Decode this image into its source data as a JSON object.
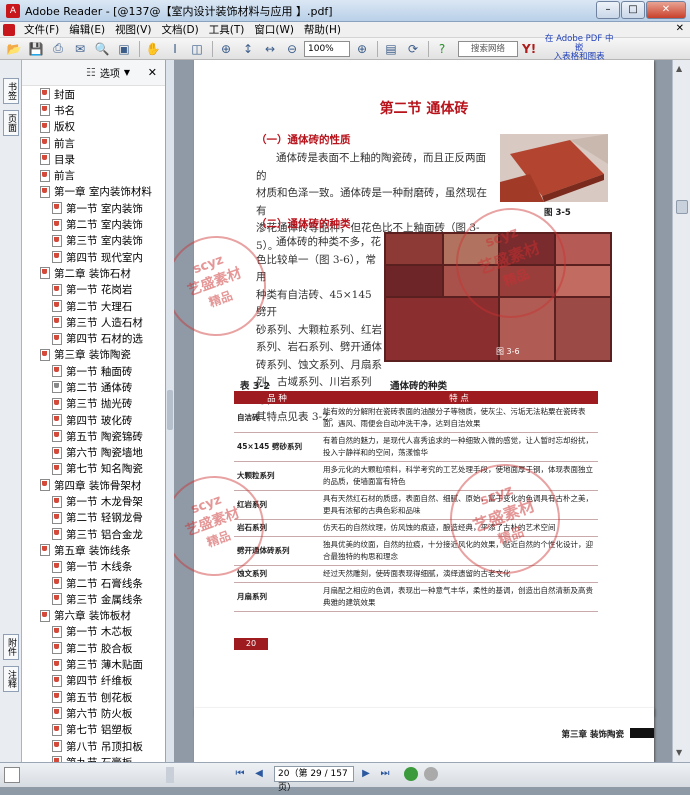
{
  "window": {
    "title": "Adobe Reader - [@137@【室内设计装饰材料与应用 】.pdf]",
    "min": "–",
    "max": "□",
    "close": "✕"
  },
  "menu": {
    "items": [
      "文件(F)",
      "编辑(E)",
      "视图(V)",
      "文档(D)",
      "工具(T)",
      "窗口(W)",
      "帮助(H)"
    ],
    "close": "✕"
  },
  "toolbar": {
    "zoom": "100%",
    "search_placeholder": "搜索网络",
    "ad_line1": "在 Adobe PDF 中嵌",
    "ad_line2": "入表格和图表"
  },
  "left_tabs": [
    "书签",
    "页面",
    "附件",
    "注释"
  ],
  "panel": {
    "options": "选项",
    "close": "✕"
  },
  "bookmarks": [
    {
      "label": "封面",
      "level": 0
    },
    {
      "label": "书名",
      "level": 0
    },
    {
      "label": "版权",
      "level": 0
    },
    {
      "label": "前言",
      "level": 0
    },
    {
      "label": "目录",
      "level": 0
    },
    {
      "label": "前言",
      "level": 0
    },
    {
      "label": "第一章  室内装饰材料",
      "level": 0
    },
    {
      "label": "第一节  室内装饰",
      "level": 1
    },
    {
      "label": "第二节  室内装饰",
      "level": 1
    },
    {
      "label": "第三节  室内装饰",
      "level": 1
    },
    {
      "label": "第四节  现代室内",
      "level": 1
    },
    {
      "label": "第二章  装饰石材",
      "level": 0
    },
    {
      "label": "第一节  花岗岩",
      "level": 1
    },
    {
      "label": "第二节  大理石",
      "level": 1
    },
    {
      "label": "第三节  人造石材",
      "level": 1
    },
    {
      "label": "第四节  石材的选",
      "level": 1
    },
    {
      "label": "第三章  装饰陶瓷",
      "level": 0
    },
    {
      "label": "第一节  釉面砖",
      "level": 1
    },
    {
      "label": "第二节  通体砖",
      "level": 1,
      "gray": true
    },
    {
      "label": "第三节  抛光砖",
      "level": 1
    },
    {
      "label": "第四节  玻化砖",
      "level": 1
    },
    {
      "label": "第五节  陶瓷锦砖",
      "level": 1
    },
    {
      "label": "第六节  陶瓷墙地",
      "level": 1
    },
    {
      "label": "第七节  知名陶瓷",
      "level": 1
    },
    {
      "label": "第四章  装饰骨架材",
      "level": 0
    },
    {
      "label": "第一节  木龙骨架",
      "level": 1
    },
    {
      "label": "第二节  轻钢龙骨",
      "level": 1
    },
    {
      "label": "第三节  铝合金龙",
      "level": 1
    },
    {
      "label": "第五章  装饰线条",
      "level": 0
    },
    {
      "label": "第一节  木线条",
      "level": 1
    },
    {
      "label": "第二节  石膏线条",
      "level": 1
    },
    {
      "label": "第三节  金属线条",
      "level": 1
    },
    {
      "label": "第六章  装饰板材",
      "level": 0
    },
    {
      "label": "第一节  木芯板",
      "level": 1
    },
    {
      "label": "第二节  胶合板",
      "level": 1
    },
    {
      "label": "第三节  薄木贴面",
      "level": 1
    },
    {
      "label": "第四节  纤维板",
      "level": 1
    },
    {
      "label": "第五节  刨花板",
      "level": 1
    },
    {
      "label": "第六节  防火板",
      "level": 1
    },
    {
      "label": "第七节  铝塑板",
      "level": 1
    },
    {
      "label": "第八节  吊顶扣板",
      "level": 1
    },
    {
      "label": "第九节  石膏板",
      "level": 1
    }
  ],
  "document": {
    "section_title": "第二节  通体砖",
    "sub1": "（一）通体砖的性质",
    "para1_l1": "通体砖是表面不上釉的陶瓷砖，而且正反两面的",
    "para1_l2": "材质和色泽一致。通体砖是一种耐磨砖，虽然现在有",
    "para1_l3": "渗花通体砖等品种，但花色比不上釉面砖（图 3-5）。",
    "fig35": "图 3-5",
    "sub2": "（二）通体砖的种类",
    "para2": [
      "通体砖的种类不多，花",
      "色比较单一（图 3-6），常用",
      "种类有自洁砖、45×145 劈开",
      "砂系列、大颗粒系列、红岩",
      "系列、岩石系列、劈开通体",
      "砖系列、蚀文系列、月扇系",
      "列、古域系列、川岩系列等，",
      "其特点见表 3-2。"
    ],
    "fig36": "图 3-6",
    "table_no": "表 3-2",
    "table_title": "通体砖的种类",
    "table_head": [
      "品  种",
      "特  点"
    ],
    "table_rows": [
      [
        "自洁砖",
        "能有效的分解附在瓷砖表面的油酸分子等物质，使灰尘、污垢无法粘粟在瓷砖表面，遇风、雨便会自动冲洗干净，达到自洁效果"
      ],
      [
        "45×145 劈砂系列",
        "有着自然的魅力，是现代人喜秀追求的一种细致入微的感觉，让人暂时忘却纷扰，投入宁静祥和的空间，荡漾愉华"
      ],
      [
        "大颗粒系列",
        "用多元化的大颗粒喷料，科学考究的工艺处理手段，使地面厚于钢，体现表面独立的品质，使墙面富有特色"
      ],
      [
        "红岩系列",
        "具有天然红石材的质感，表面自然、细腻、原始，富于变化的色调具有古朴之美，更具有浓郁的古典色彩和品味"
      ],
      [
        "岩石系列",
        "仿天石的自然纹理，仿风蚀的痕迹，酿造经典，平添了古朴的艺术空间"
      ],
      [
        "劈开通体砖系列",
        "独具优美的纹面，自然的拉痕，十分接近风化的效果，贴近自然的个性化设计，迎合最独特的构思和理念"
      ],
      [
        "蚀文系列",
        "经过天然雕刻，使砖面表现得细腻，演绎遗留的古老文化"
      ],
      [
        "月扇系列",
        "月扇配之相应的色调，表现出一种意气丰华，柔性的基调，创造出自然清新及高贵典雅的建筑效果"
      ]
    ],
    "page_number": "20",
    "next_header": "第三章  装饰陶瓷",
    "watermark_1": "scyz",
    "watermark_2": "艺盛素材",
    "watermark_3": "精品"
  },
  "status": {
    "page_display": "20（第 29 / 157 页）"
  },
  "colors": {
    "accent": "#b8121b",
    "table_header": "#9e1b20"
  }
}
